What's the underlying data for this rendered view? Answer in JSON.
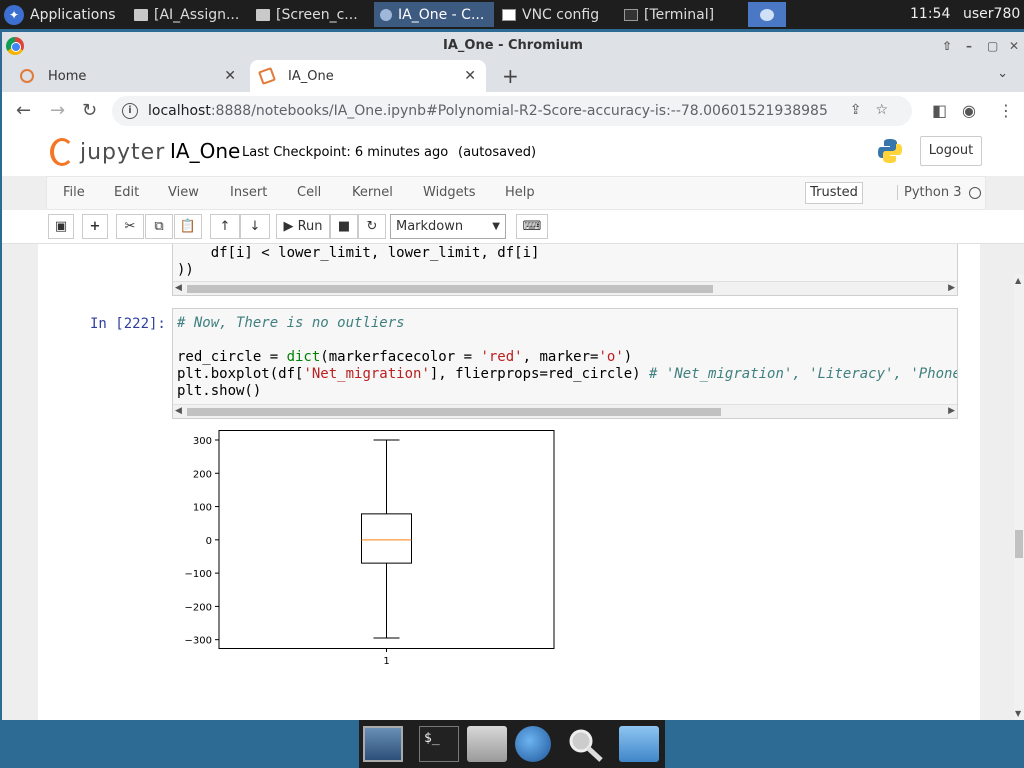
{
  "taskbar": {
    "apps_label": "Applications",
    "tasks": [
      "[AI_Assign...",
      "[Screen_c...",
      "IA_One - C...",
      "VNC config",
      "[Terminal]"
    ],
    "clock": "11:54",
    "user": "user780"
  },
  "browser": {
    "window_title": "IA_One - Chromium",
    "tabs": [
      {
        "label": "Home"
      },
      {
        "label": "IA_One"
      }
    ],
    "url_host": "localhost",
    "url_path": ":8888/notebooks/IA_One.ipynb#Polynomial-R2-Score-accuracy-is:--78.00601521938985"
  },
  "jupyter": {
    "logo_text": "jupyter",
    "notebook_name": "IA_One",
    "checkpoint": "Last Checkpoint: 6 minutes ago",
    "autosaved": "(autosaved)",
    "logout": "Logout",
    "menu": [
      "File",
      "Edit",
      "View",
      "Insert",
      "Cell",
      "Kernel",
      "Widgets",
      "Help"
    ],
    "trusted": "Trusted",
    "kernel": "Python 3",
    "run_label": "Run",
    "cell_type": "Markdown"
  },
  "cells": {
    "prev_line1": "    df[i] < lower_limit, lower_limit, df[i]",
    "prev_line2": "))",
    "prompt": "In [222]:",
    "comment": "# Now, There is no outliers",
    "line2a": "red_circle = ",
    "line2b": "dict",
    "line2c": "(markerfacecolor = ",
    "line2d": "'red'",
    "line2e": ", marker=",
    "line2f": "'o'",
    "line2g": ")",
    "line3a": "plt.boxplot(df[",
    "line3b": "'Net_migration'",
    "line3c": "], flierprops=red_circle) ",
    "line3d": "# 'Net_migration', 'Literacy', 'Phone",
    "line4": "plt.show()"
  },
  "chart_data": {
    "type": "boxplot",
    "categories": [
      "1"
    ],
    "box": {
      "min": -295,
      "q1": -70,
      "median": 0,
      "q3": 78,
      "max": 300
    },
    "yticks": [
      300,
      200,
      100,
      0,
      -100,
      -200,
      -300
    ],
    "ylim": [
      -325,
      330
    ],
    "median_color": "#ff7f0e"
  }
}
